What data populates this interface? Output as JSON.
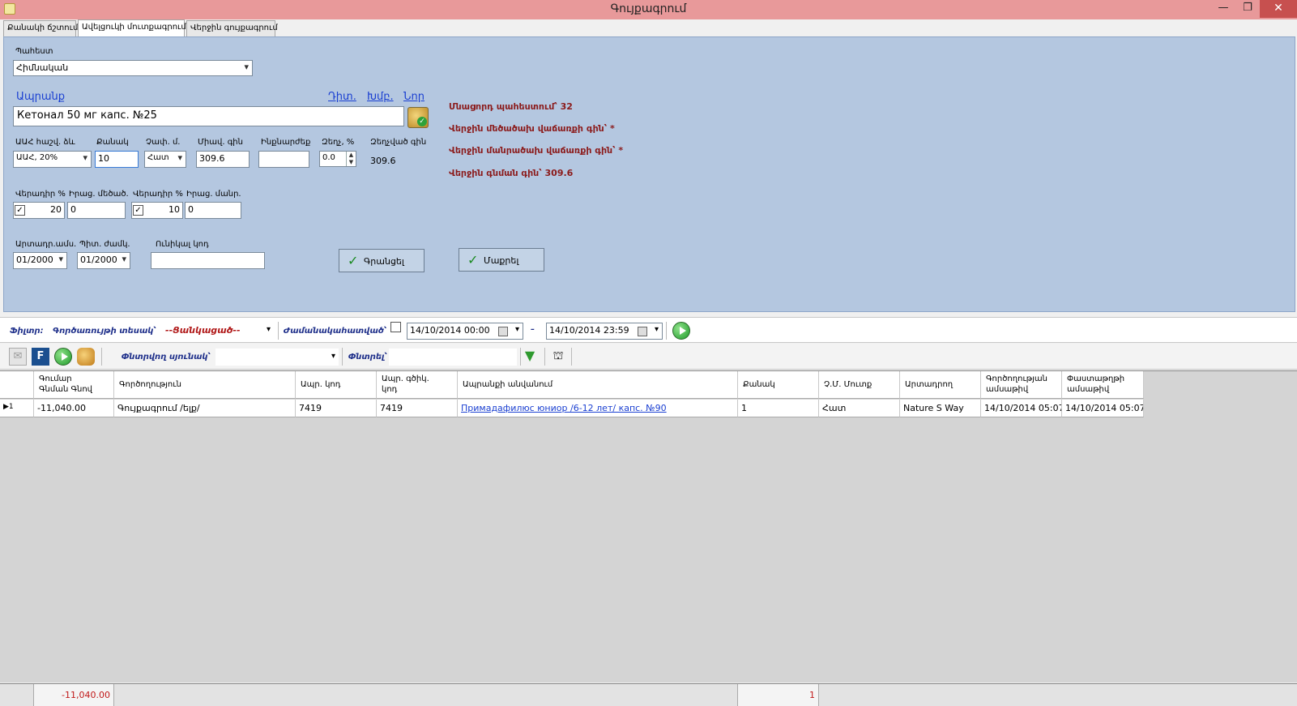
{
  "window": {
    "title": "Գույքագրում"
  },
  "tabs": [
    {
      "label": "Քանակի ճշտում"
    },
    {
      "label": "Ավելցուկի մուտքագրում"
    },
    {
      "label": "Վերջին գույքագրում"
    }
  ],
  "form": {
    "warehouse_label": "Պահեստ",
    "warehouse_value": "Հիմնական",
    "product_label": "Ապրանք",
    "links": {
      "find": "Դիտ.",
      "edit": "Խմբ.",
      "new": "Նոր"
    },
    "product_value": "Кетонал 50 мг капс. №25",
    "vat_label": "ԱԱՀ հաշվ. ձև",
    "vat_value": "ԱԱՀ, 20%",
    "qty_label": "Քանակ",
    "qty_value": "10",
    "unit_label": "Չափ. մ.",
    "unit_value": "Հատ",
    "unit_price_label": "Միավ. գին",
    "unit_price_value": "309.6",
    "cost_label": "Ինքնարժեք",
    "cost_value": "",
    "discount_label": "Զեղչ, %",
    "discount_value": "0.0",
    "discounted_price_label": "Զեղչված գին",
    "discounted_price_value": "309.6",
    "markup1_label": "Վերադիր %",
    "markup1_value": "20",
    "retail_ws_label": "Իրաց. մեծած.",
    "retail_ws_value": "0",
    "markup2_label": "Վերադիր %",
    "markup2_value": "10",
    "retail_rt_label": "Իրաց. մանր.",
    "retail_rt_value": "0",
    "prod_date_label": "Արտադր.ամս.",
    "prod_date_value": "01/2000",
    "expiry_label": "Պիտ. ժամկ.",
    "expiry_value": "01/2000",
    "barcode_label": "Ունիկալ կոդ",
    "barcode_value": "",
    "write_button": "Գրանցել",
    "clear_button": "Մաքրել",
    "info": {
      "stock": "Մնացորդ պահեստում՝ 32",
      "last_ws_price": "Վերջին մեծածախ վաճառքի գին՝ *",
      "last_rt_price": "Վերջին մանրածախ վաճառքի գին՝ *",
      "last_buy_price": "Վերջին գնման գին՝ 309.6"
    }
  },
  "filterbar": {
    "filter_label": "Ֆիլտր:",
    "optype_label": "Գործառույթի տեսակ՝",
    "optype_value": "--Ցանկացած--",
    "period_label": "Ժամանակահատված՝",
    "date_from": "14/10/2014 00:00",
    "dash": "–",
    "date_to": "14/10/2014 23:59"
  },
  "toolbar": {
    "search_column_label": "Փնտրվող սյունակ՝",
    "search_column_value": "",
    "search_label": "Փնտրել՝",
    "search_value": ""
  },
  "grid": {
    "headers": [
      "Գումար\nԳնման Գնով",
      "Գործողություն",
      "Ապր. կոդ",
      "Ապր. գծիկ.\nկոդ",
      "Ապրանքի անվանում",
      "Քանակ",
      "Չ.Մ. Մուտք",
      "Արտադրող",
      "Գործողության\nամսաթիվ",
      "Փաստաթղթի\nամսաթիվ"
    ],
    "rows": [
      {
        "indicator": "▶1",
        "sum": "-11,040.00",
        "operation": "Գույքագրում /ելք/",
        "code": "7419",
        "barcode": "7419",
        "name": "Примадафилюс юниор /6-12 лет/ капс. №90",
        "qty": "1",
        "unit": "Հատ",
        "producer": "Nature S Way",
        "op_date": "14/10/2014 05:07",
        "doc_date": "14/10/2014 05:07"
      }
    ]
  },
  "footer": {
    "sum_total": "-11,040.00",
    "qty_total": "1"
  }
}
